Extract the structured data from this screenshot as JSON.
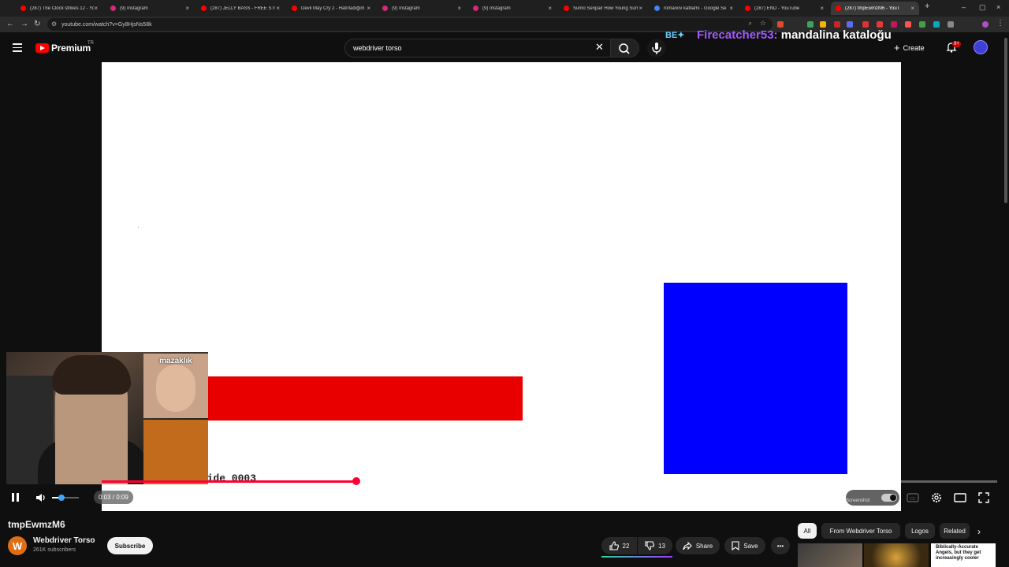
{
  "browser": {
    "tabs": [
      {
        "title": "(287) The Clock strikes 12 - Yo",
        "fav_color": "#ff0000"
      },
      {
        "title": "(9) Instagram",
        "fav_color": "#d62976"
      },
      {
        "title": "(287) JELLY BASS - FREE STUFF",
        "fav_color": "#ff0000"
      },
      {
        "title": "Devil May Cry 2 - Hatırladığım",
        "fav_color": "#ff0000"
      },
      {
        "title": "(9) Instagram",
        "fav_color": "#d62976"
      },
      {
        "title": "(9) Instagram",
        "fav_color": "#d62976"
      },
      {
        "title": "Sumo Senpai! How Young Sumo",
        "fav_color": "#ff0000"
      },
      {
        "title": "romanov katliamı - Google Se",
        "fav_color": "#4285f4"
      },
      {
        "title": "(287) END - YouTube",
        "fav_color": "#ff0000"
      },
      {
        "title": "(287) tmpEwmzM6 - YouT",
        "fav_color": "#ff0000"
      }
    ],
    "url": "youtube.com/watch?v=Gy8HjsNs58k",
    "new_tab_label": "+"
  },
  "header": {
    "brand": "Premium",
    "country": "TR",
    "search_query": "webdriver torso",
    "create_label": "Create",
    "notification_count": "9+"
  },
  "overlay": {
    "username": "Firecatcher53:",
    "message": "mandalina kataloğu"
  },
  "video": {
    "slide_text": "Slide 0003",
    "webcam_inset_label": "mazaklık",
    "current_time": "0:03",
    "duration": "0:09",
    "time_display": "0:03 / 0:09",
    "progress_fraction": 0.284,
    "volume_fraction": 0.35,
    "autoplay_label": "Screenshot"
  },
  "info": {
    "title": "tmpEwmzM6",
    "channel": "Webdriver Torso",
    "channel_initial": "W",
    "subscribers": "261K subscribers",
    "subscribe_label": "Subscribe",
    "likes": "22",
    "dislikes": "13",
    "share_label": "Share",
    "save_label": "Save"
  },
  "chips": [
    {
      "label": "All",
      "selected": true
    },
    {
      "label": "From Webdriver Torso",
      "selected": false
    },
    {
      "label": "Logos",
      "selected": false
    },
    {
      "label": "Related",
      "selected": false
    }
  ],
  "recommendation_caption": "Biblically-Accurate Angels, but they get increasingly cooler",
  "colors": {
    "accent": "#ff0033",
    "red_rect": "#e80000",
    "blue_rect": "#0000ff",
    "background": "#0f0f0f"
  }
}
